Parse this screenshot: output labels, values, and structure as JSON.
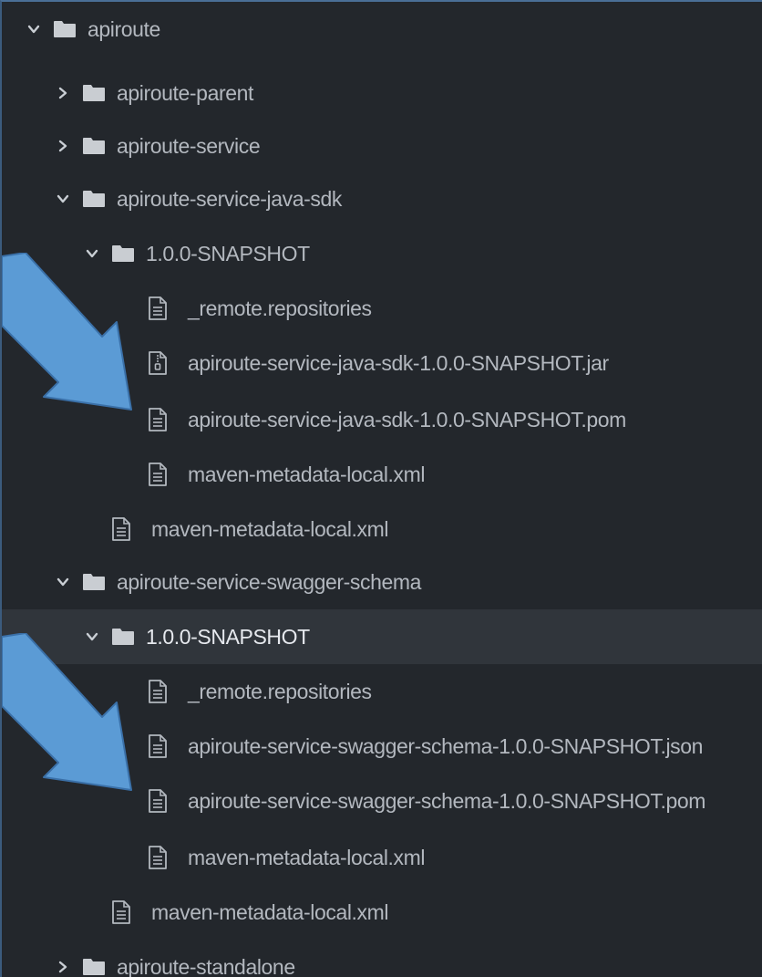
{
  "tree": {
    "root": {
      "label": "apiroute",
      "state": "expanded"
    },
    "parent": {
      "label": "apiroute-parent",
      "state": "collapsed"
    },
    "service": {
      "label": "apiroute-service",
      "state": "collapsed"
    },
    "java_sdk": {
      "label": "apiroute-service-java-sdk",
      "state": "expanded",
      "version": {
        "label": "1.0.0-SNAPSHOT",
        "state": "expanded",
        "files": [
          {
            "label": "_remote.repositories",
            "icon": "file-icon"
          },
          {
            "label": "apiroute-service-java-sdk-1.0.0-SNAPSHOT.jar",
            "icon": "archive-file-icon"
          },
          {
            "label": "apiroute-service-java-sdk-1.0.0-SNAPSHOT.pom",
            "icon": "file-icon"
          },
          {
            "label": "maven-metadata-local.xml",
            "icon": "file-icon"
          }
        ]
      },
      "metadata": {
        "label": "maven-metadata-local.xml"
      }
    },
    "swagger_schema": {
      "label": "apiroute-service-swagger-schema",
      "state": "expanded",
      "version": {
        "label": "1.0.0-SNAPSHOT",
        "state": "expanded",
        "selected": true,
        "files": [
          {
            "label": "_remote.repositories",
            "icon": "file-icon"
          },
          {
            "label": "apiroute-service-swagger-schema-1.0.0-SNAPSHOT.json",
            "icon": "file-icon"
          },
          {
            "label": "apiroute-service-swagger-schema-1.0.0-SNAPSHOT.pom",
            "icon": "file-icon"
          },
          {
            "label": "maven-metadata-local.xml",
            "icon": "file-icon"
          }
        ]
      },
      "metadata": {
        "label": "maven-metadata-local.xml"
      }
    },
    "standalone": {
      "label": "apiroute-standalone",
      "state": "collapsed"
    }
  },
  "colors": {
    "background": "#23272c",
    "selected_row": "#30353b",
    "text": "#b3b8bf",
    "folder": "#c9cdd2",
    "arrow_fill": "#5b9bd5",
    "arrow_stroke": "#3a70a8"
  }
}
